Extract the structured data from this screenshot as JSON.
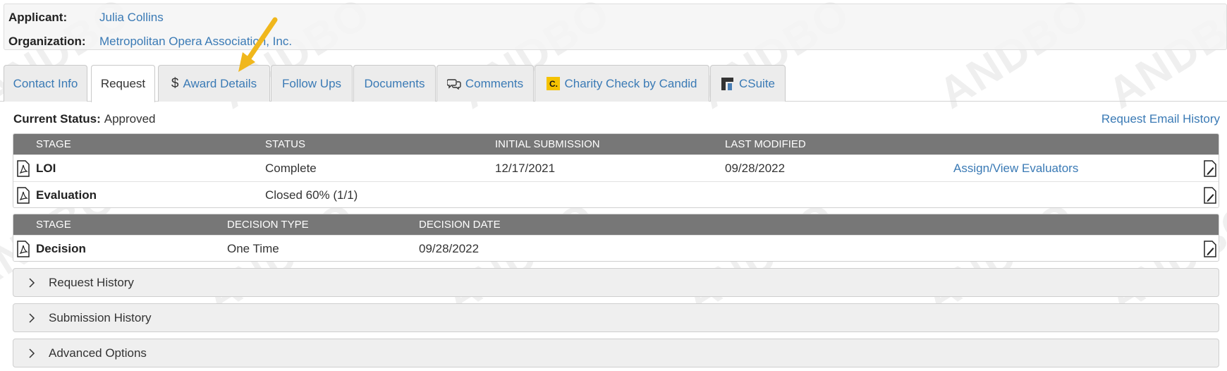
{
  "applicant": {
    "label": "Applicant:",
    "value": "Julia Collins"
  },
  "organization": {
    "label": "Organization:",
    "value": "Metropolitan Opera Association, Inc."
  },
  "tabs": [
    {
      "label": "Contact Info",
      "icon": ""
    },
    {
      "label": "Request",
      "icon": ""
    },
    {
      "label": "Award Details",
      "icon": "dollar-icon"
    },
    {
      "label": "Follow Ups",
      "icon": ""
    },
    {
      "label": "Documents",
      "icon": ""
    },
    {
      "label": "Comments",
      "icon": "comments-icon"
    },
    {
      "label": "Charity Check by Candid",
      "icon": "candid-logo-icon",
      "icon_text": "C."
    },
    {
      "label": "CSuite",
      "icon": "csuite-logo-icon"
    }
  ],
  "active_tab": "Request",
  "current_status": {
    "label": "Current Status:",
    "value": "Approved"
  },
  "request_email_history": "Request Email History",
  "stages_table": {
    "headers": [
      "STAGE",
      "STATUS",
      "INITIAL SUBMISSION",
      "LAST MODIFIED"
    ],
    "rows": [
      {
        "stage": "LOI",
        "status": "Complete",
        "initial_submission": "12/17/2021",
        "last_modified": "09/28/2022",
        "action": "Assign/View Evaluators"
      },
      {
        "stage": "Evaluation",
        "status": "Closed 60% (1/1)",
        "initial_submission": "",
        "last_modified": "",
        "action": ""
      }
    ]
  },
  "decision_table": {
    "headers": [
      "STAGE",
      "DECISION TYPE",
      "DECISION DATE"
    ],
    "rows": [
      {
        "stage": "Decision",
        "decision_type": "One Time",
        "decision_date": "09/28/2022"
      }
    ]
  },
  "accordions": [
    "Request History",
    "Submission History",
    "Advanced Options"
  ],
  "colors": {
    "link": "#3a7ab5",
    "table_header": "#777777",
    "arrow": "#f0b71c",
    "candid": "#f5c200"
  }
}
